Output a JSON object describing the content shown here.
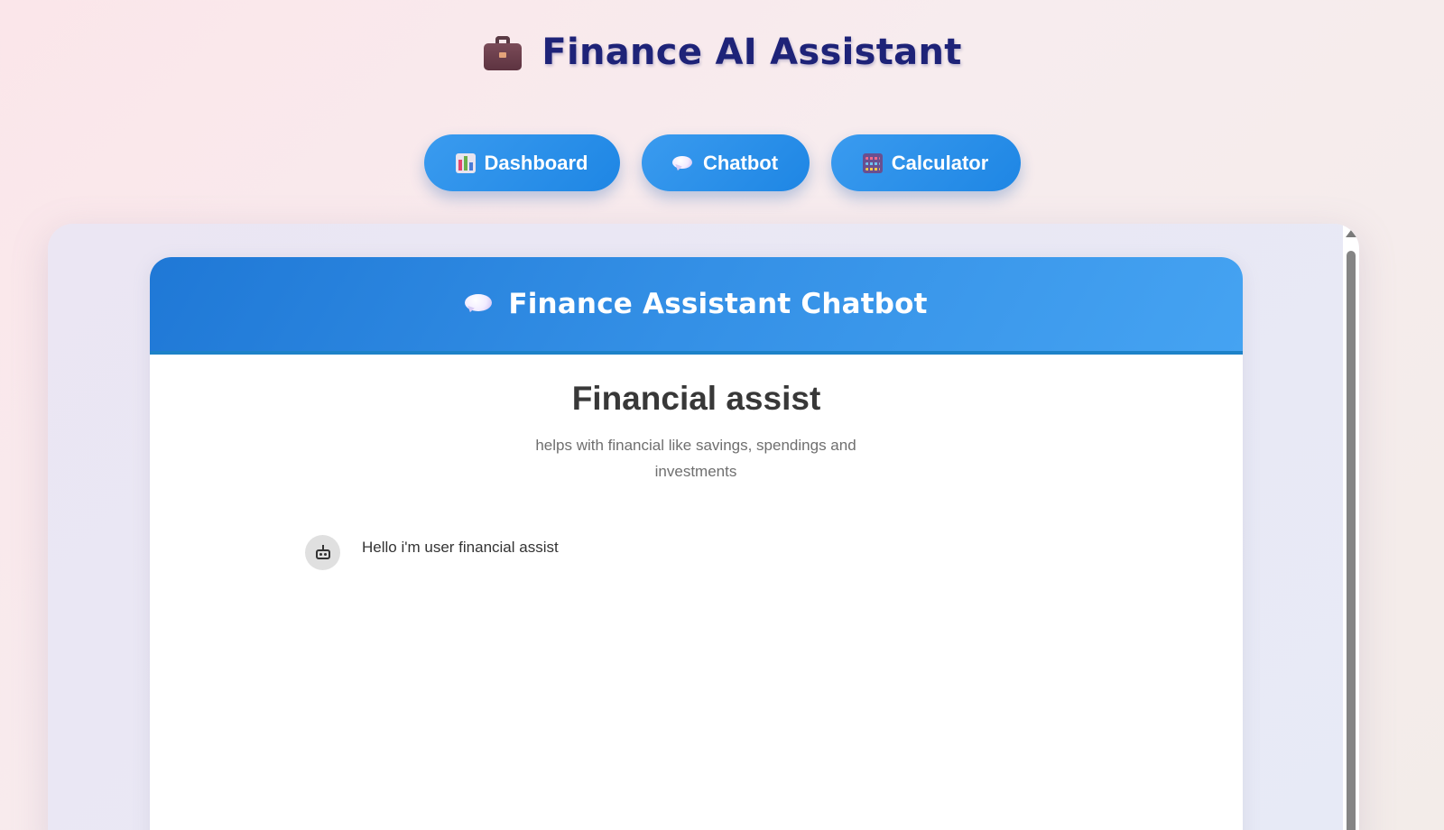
{
  "header": {
    "title": "Finance AI Assistant",
    "icon": "briefcase-icon"
  },
  "nav": {
    "items": [
      {
        "label": "Dashboard",
        "icon": "chart-icon"
      },
      {
        "label": "Chatbot",
        "icon": "speech-bubble-icon"
      },
      {
        "label": "Calculator",
        "icon": "abacus-icon"
      }
    ]
  },
  "chat": {
    "title": "Finance Assistant Chatbot",
    "icon": "speech-bubble-icon",
    "intro_title": "Financial assist",
    "intro_description": "helps with financial like savings, spendings and investments",
    "messages": [
      {
        "sender": "bot",
        "avatar_icon": "robot-icon",
        "text": "Hello i'm user financial assist"
      }
    ]
  },
  "colors": {
    "accent": "#1e86e4",
    "title": "#1e2378",
    "background": "#fbe6ea"
  }
}
